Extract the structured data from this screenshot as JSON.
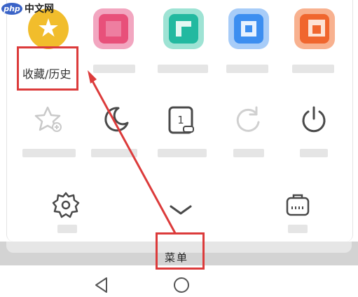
{
  "watermark": {
    "logo": "php",
    "text": "中文网"
  },
  "row1": {
    "favorites_label": "收藏/历史",
    "tiles": [
      {
        "icon": "star-icon",
        "color": "#f1bd2c"
      },
      {
        "icon": "pixelated-app-icon",
        "color": "#e8507a"
      },
      {
        "icon": "pixelated-app-icon",
        "color": "#22b9a0"
      },
      {
        "icon": "pixelated-app-icon",
        "color": "#3c8ef0"
      },
      {
        "icon": "pixelated-app-icon",
        "color": "#f0662e"
      }
    ]
  },
  "row2": {
    "icons": [
      "add-bookmark-icon",
      "night-mode-icon",
      "page-mode-icon",
      "refresh-icon",
      "power-icon"
    ]
  },
  "bottom_row": {
    "icons": [
      "settings-icon",
      "collapse-chevron-icon",
      "toolbox-icon"
    ]
  },
  "menu_label": "菜单",
  "nav": {
    "icons": [
      "back-triangle-icon",
      "home-circle-icon"
    ]
  },
  "colors": {
    "highlight": "#dc3b3b",
    "arrow": "#dc3b3b"
  }
}
